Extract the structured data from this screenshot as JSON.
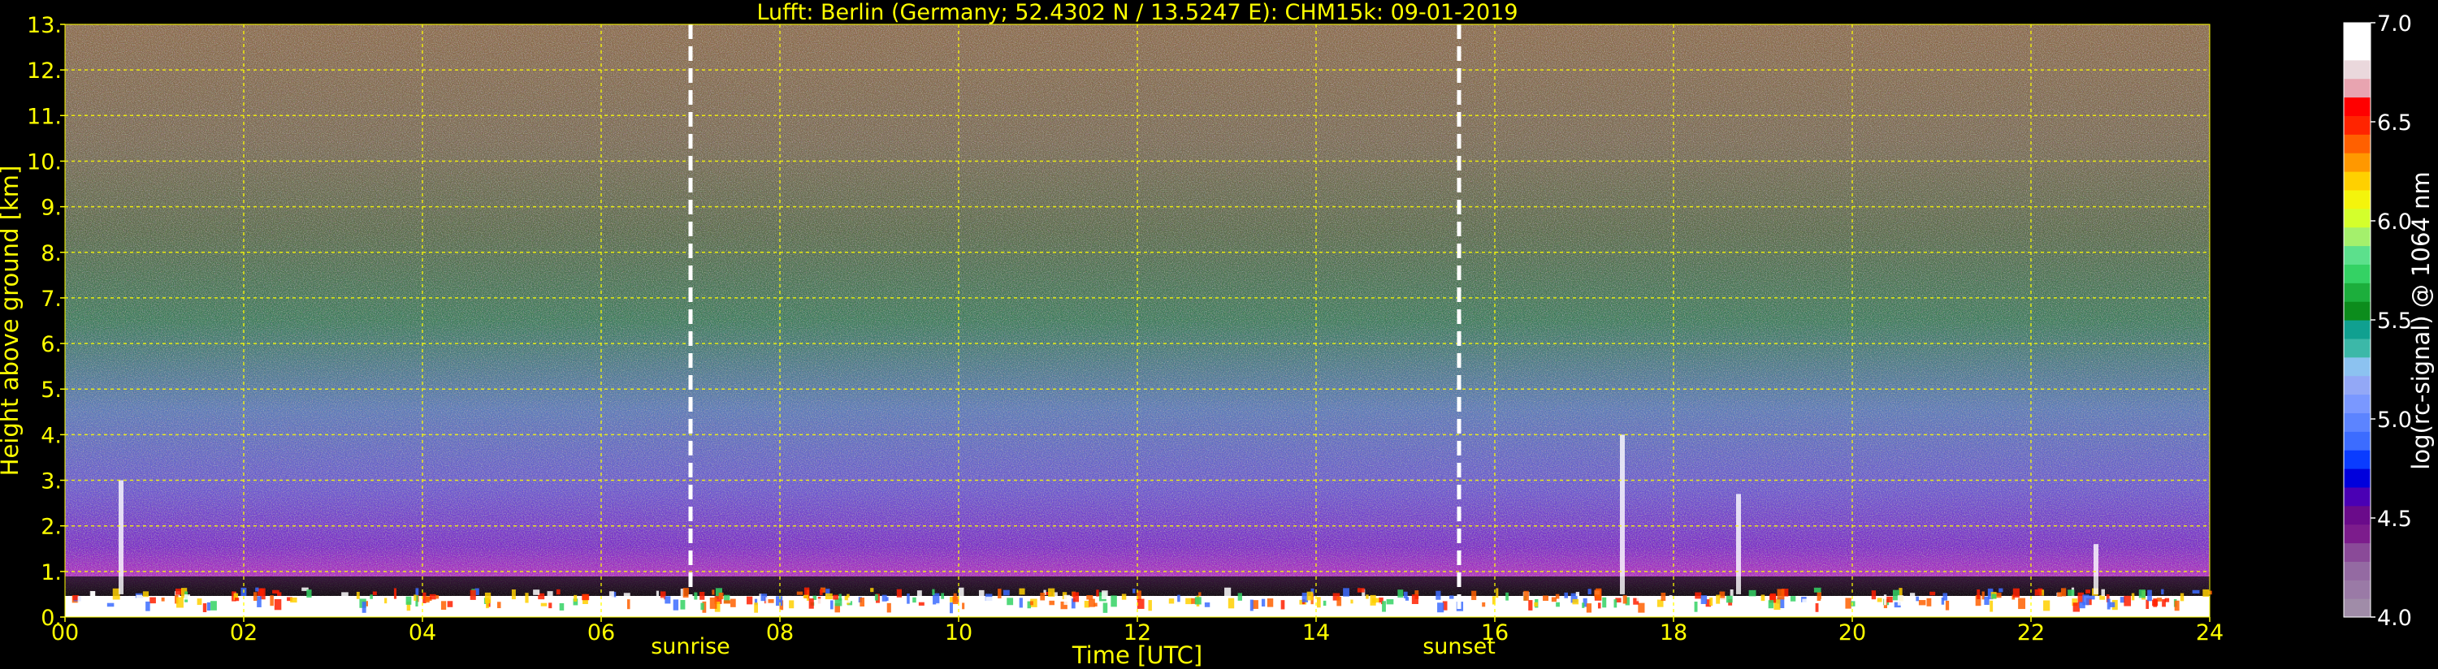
{
  "chart_data": {
    "type": "heatmap",
    "title": "Lufft: Berlin (Germany; 52.4302 N / 13.5247 E):    CHM15k: 09-01-2019",
    "xlabel": "Time [UTC]",
    "ylabel": "Height above ground [km]",
    "xlim": [
      0,
      24
    ],
    "ylim": [
      0,
      13
    ],
    "x_ticks": [
      "00",
      "02",
      "04",
      "06",
      "08",
      "10",
      "12",
      "14",
      "16",
      "18",
      "20",
      "22",
      "24"
    ],
    "y_ticks": [
      "0.",
      "1.",
      "2.",
      "3.",
      "4.",
      "5.",
      "6.",
      "7.",
      "8.",
      "9.",
      "10.",
      "11.",
      "12.",
      "13."
    ],
    "grid": true,
    "grid_color": "#ffff00",
    "events": [
      {
        "label": "sunrise",
        "time": 7.0
      },
      {
        "label": "sunset",
        "time": 15.6
      }
    ],
    "colorbar": {
      "label": "log(rc-signal) @ 1064 nm",
      "range": [
        4.0,
        7.0
      ],
      "ticks": [
        "4.0",
        "4.5",
        "5.0",
        "5.5",
        "6.0",
        "6.5",
        "7.0"
      ],
      "colors": [
        "#a08ca8",
        "#9a7aa6",
        "#946aa2",
        "#8a4a98",
        "#7c1c8c",
        "#6a0b8a",
        "#4a00b4",
        "#0000dc",
        "#0a3cff",
        "#3c6cff",
        "#5c84ff",
        "#7a98ff",
        "#93a8f6",
        "#8cc2f0",
        "#3cb8a8",
        "#10a090",
        "#0c8c1c",
        "#1cae3c",
        "#34d264",
        "#5ce08c",
        "#a4f06c",
        "#d4ff2c",
        "#f4f40c",
        "#ffd000",
        "#ff9800",
        "#ff6000",
        "#ff2400",
        "#ff0000",
        "#e8a4b0",
        "#ead8dc",
        "#ffffff",
        "#ffffff"
      ]
    },
    "description": "Backscatter profile: noisy high-altitude signal with boundary layer below ~0.8 km; strong low-level signal all day; brief columns near 17.4 UTC and 22.7 UTC"
  }
}
